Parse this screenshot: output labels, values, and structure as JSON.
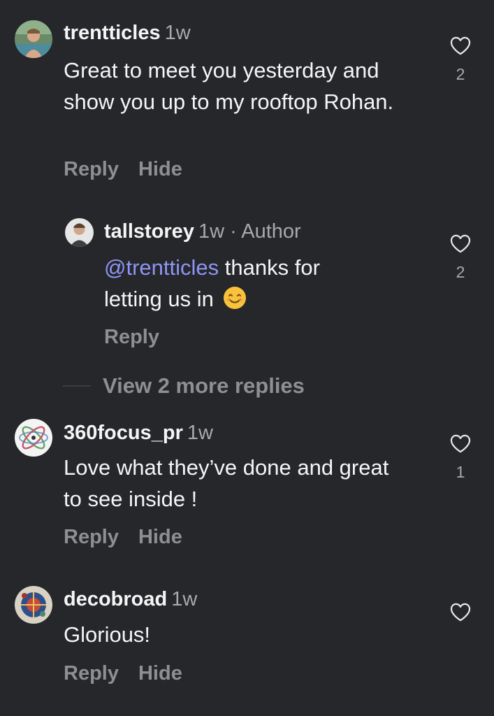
{
  "comments": [
    {
      "username": "trentticles",
      "time": "1w",
      "text": "Great to meet you yesterday and show you up to my rooftop Rohan.",
      "reply_label": "Reply",
      "hide_label": "Hide",
      "likes": "2"
    },
    {
      "username": "tallstorey",
      "time": "1w",
      "separator": "·",
      "author_tag": "Author",
      "mention": "@trentticles",
      "text": "thanks for letting us in",
      "emoji": "😊",
      "reply_label": "Reply",
      "likes": "2"
    },
    {
      "username": "360focus_pr",
      "time": "1w",
      "text": "Love what they’ve done and great to see inside !",
      "reply_label": "Reply",
      "hide_label": "Hide",
      "likes": "1"
    },
    {
      "username": "decobroad",
      "time": "1w",
      "text": "Glorious!",
      "reply_label": "Reply",
      "hide_label": "Hide"
    }
  ],
  "view_more_replies": "View 2 more replies",
  "colors": {
    "background": "#26272b",
    "mention": "#8f95f4",
    "muted": "#8e8e93"
  },
  "icons": {
    "like": "heart-icon",
    "emoji": "smiling-face-icon"
  }
}
